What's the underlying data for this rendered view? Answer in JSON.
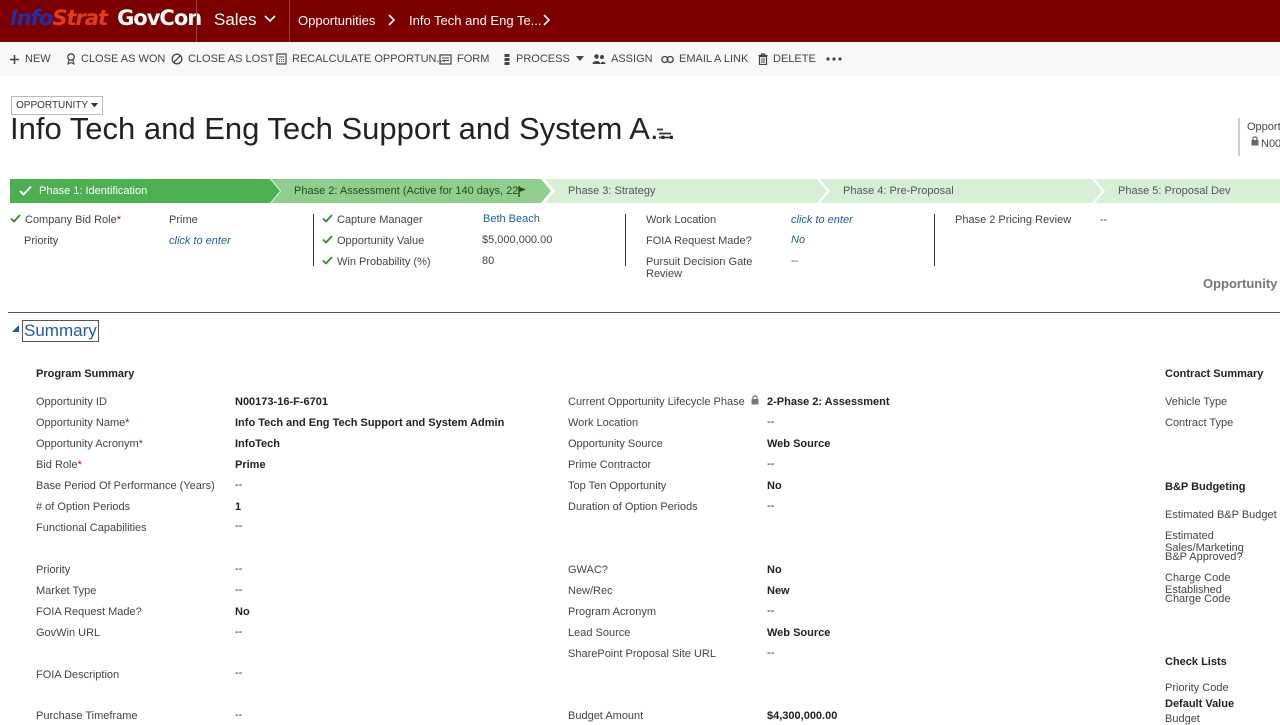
{
  "nav": {
    "logo_part1": "Info",
    "logo_part2": "Strat",
    "logo_part3": "GovCon",
    "app": "Sales",
    "entity": "Opportunities",
    "record": "Info Tech and Eng Te..."
  },
  "commands": [
    "NEW",
    "CLOSE AS WON",
    "CLOSE AS LOST",
    "RECALCULATE OPPORTUN...",
    "FORM",
    "PROCESS",
    "ASSIGN",
    "EMAIL A LINK",
    "DELETE"
  ],
  "header": {
    "entity_pill": "OPPORTUNITY",
    "title": "Info Tech and Eng Tech Support and System A...",
    "right_label": "Opport",
    "right_id": "N00"
  },
  "stages": [
    {
      "label": "Phase 1: Identification",
      "state": "completed"
    },
    {
      "label": "Phase 2: Assessment (Active for 140 days, 22",
      "state": "active"
    },
    {
      "label": "Phase 3: Strategy",
      "state": "upcoming"
    },
    {
      "label": "Phase 4: Pre-Proposal",
      "state": "upcoming"
    },
    {
      "label": "Phase 5: Proposal Dev",
      "state": "upcoming"
    }
  ],
  "stage_fields": {
    "col1": [
      {
        "label": "Company Bid Role",
        "value": "Prime"
      },
      {
        "label": "Priority",
        "value": "click to enter"
      }
    ],
    "col2": [
      {
        "label": "Capture Manager",
        "value": "Beth Beach"
      },
      {
        "label": "Opportunity Value",
        "value": "$5,000,000.00"
      },
      {
        "label": "Win Probability (%)",
        "value": "80"
      }
    ],
    "col3": [
      {
        "label": "Work Location",
        "value": "click to enter"
      },
      {
        "label": "FOIA Request Made?",
        "value": "No"
      },
      {
        "label": "Pursuit Decision Gate Review",
        "value": "--"
      }
    ],
    "col4": [
      {
        "label": "Phase 2 Pricing Review",
        "value": "--"
      }
    ]
  },
  "opportunity_caption": "Opportunity",
  "summary": {
    "title": "Summary",
    "program_summary": "Program Summary",
    "left": [
      {
        "label": "Opportunity ID",
        "value": "N00173-16-F-6701"
      },
      {
        "label": "Opportunity Name",
        "value": "Info Tech and Eng Tech Support and System Admin"
      },
      {
        "label": "Opportunity Acronym",
        "value": "InfoTech"
      },
      {
        "label": "Bid Role",
        "value": "Prime"
      },
      {
        "label": "Base Period Of Performance (Years)",
        "value": "--"
      },
      {
        "label": "# of Option Periods",
        "value": "1"
      },
      {
        "label": "Functional Capabilities",
        "value": "--"
      },
      {
        "label": "Priority",
        "value": "--"
      },
      {
        "label": "Market Type",
        "value": "--"
      },
      {
        "label": "FOIA Request Made?",
        "value": "No"
      },
      {
        "label": "GovWin URL",
        "value": "--"
      },
      {
        "label": "FOIA Description",
        "value": "--"
      },
      {
        "label": "Purchase Timeframe",
        "value": "--"
      }
    ],
    "middle": [
      {
        "label": "Current Opportunity Lifecycle Phase",
        "value": "2-Phase 2: Assessment"
      },
      {
        "label": "Work Location",
        "value": "--"
      },
      {
        "label": "Opportunity Source",
        "value": "Web Source"
      },
      {
        "label": "Prime Contractor",
        "value": "--"
      },
      {
        "label": "Top Ten Opportunity",
        "value": "No"
      },
      {
        "label": "Duration of Option Periods",
        "value": "--"
      },
      {
        "label": "GWAC?",
        "value": "No"
      },
      {
        "label": "New/Rec",
        "value": "New"
      },
      {
        "label": "Program Acronym",
        "value": "--"
      },
      {
        "label": "Lead Source",
        "value": "Web Source"
      },
      {
        "label": "SharePoint Proposal Site URL",
        "value": "--"
      },
      {
        "label": "Budget Amount",
        "value": "$4,300,000.00"
      }
    ],
    "contract_summary": "Contract Summary",
    "right1": [
      "Vehicle Type",
      "Contract Type"
    ],
    "bp_budgeting": "B&P Budgeting",
    "right2": [
      "Estimated B&P Budget",
      "Estimated Sales/Marketing",
      "B&P Approved?",
      "Charge Code Established",
      "Charge Code"
    ],
    "check_lists": "Check Lists",
    "right3": [
      "Priority Code"
    ],
    "default_value": "Default Value",
    "budget_cut": "Budget"
  },
  "colors": {
    "nav": "#7d0000",
    "stage_done": "#4caf50",
    "stage_active": "#8fce8f",
    "stage_next": "#d7eed7",
    "link": "#1e5aa8"
  }
}
